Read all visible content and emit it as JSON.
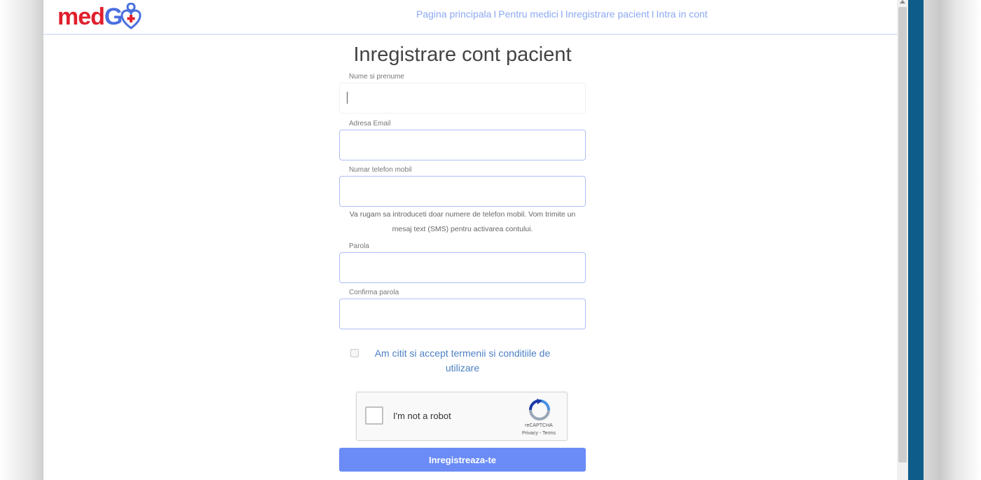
{
  "header": {
    "logo_med": "med",
    "logo_go": "G",
    "nav": [
      {
        "label": "Pagina principala"
      },
      {
        "label": "Pentru medici"
      },
      {
        "label": "Inregistrare pacient"
      },
      {
        "label": "Intra in cont"
      }
    ],
    "nav_separator": "I"
  },
  "form": {
    "title": "Inregistrare cont pacient",
    "fields": [
      {
        "label": "Nume si prenume",
        "value": ""
      },
      {
        "label": "Adresa Email",
        "value": ""
      },
      {
        "label": "Numar telefon mobil",
        "value": ""
      },
      {
        "label": "Parola",
        "value": ""
      },
      {
        "label": "Confirma parola",
        "value": ""
      }
    ],
    "phone_helper": "Va rugam sa introduceti doar numere de telefon mobil. Vom trimite un mesaj text (SMS) pentru activarea contului.",
    "terms_label": "Am citit si accept termenii si conditiile de utilizare",
    "terms_checked": false,
    "recaptcha": {
      "label": "I'm not a robot",
      "brand": "reCAPTCHA",
      "links": "Privacy - Terms"
    },
    "submit_label": "Inregistreaza-te"
  },
  "colors": {
    "logo_red": "#e0202c",
    "logo_blue": "#4a6fe0",
    "nav_link": "#8ca8f2",
    "submit_bg": "#6b8cf7",
    "terms_link": "#4d80c4",
    "side_strip": "#0d5c8a"
  }
}
